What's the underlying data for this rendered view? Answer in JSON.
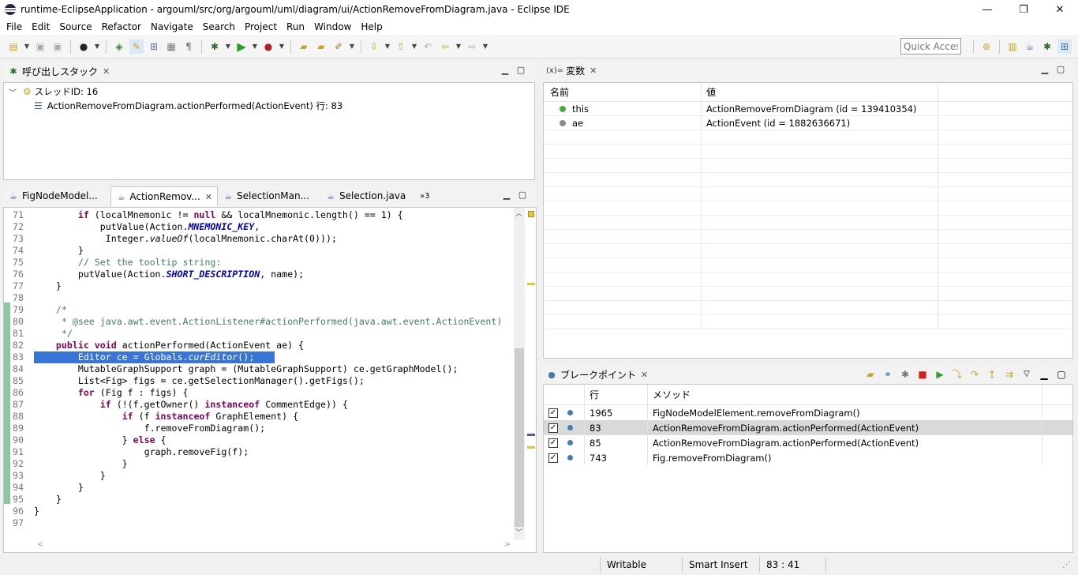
{
  "window": {
    "title": "runtime-EclipseApplication - argouml/src/org/argouml/uml/diagram/ui/ActionRemoveFromDiagram.java - Eclipse IDE",
    "minimize": "—",
    "maximize": "❐",
    "close": "✕"
  },
  "menu": [
    "File",
    "Edit",
    "Source",
    "Refactor",
    "Navigate",
    "Search",
    "Project",
    "Run",
    "Window",
    "Help"
  ],
  "toolbar": {
    "quick_access": "Quick Access"
  },
  "callstack": {
    "tab_label": "呼び出しスタック",
    "thread_label": "スレッドID: 16",
    "frame_label": "ActionRemoveFromDiagram.actionPerformed(ActionEvent) 行: 83"
  },
  "editor": {
    "tabs": [
      "FigNodeModel...",
      "ActionRemov...",
      "SelectionMan...",
      "Selection.java"
    ],
    "overflow": "»3",
    "lines": [
      {
        "n": "71",
        "code": "        if (localMnemonic != null && localMnemonic.length() == 1) {"
      },
      {
        "n": "72",
        "code": "            putValue(Action.MNEMONIC_KEY,"
      },
      {
        "n": "73",
        "code": "             Integer.valueOf(localMnemonic.charAt(0)));"
      },
      {
        "n": "74",
        "code": "        }"
      },
      {
        "n": "75",
        "code": "        // Set the tooltip string:"
      },
      {
        "n": "76",
        "code": "        putValue(Action.SHORT_DESCRIPTION, name);"
      },
      {
        "n": "77",
        "code": "    }"
      },
      {
        "n": "78",
        "code": ""
      },
      {
        "n": "79",
        "code": "    /*"
      },
      {
        "n": "80",
        "code": "     * @see java.awt.event.ActionListener#actionPerformed(java.awt.event.ActionEvent)"
      },
      {
        "n": "81",
        "code": "     */"
      },
      {
        "n": "82",
        "code": "    public void actionPerformed(ActionEvent ae) {"
      },
      {
        "n": "83",
        "code": "        Editor ce = Globals.curEditor();"
      },
      {
        "n": "84",
        "code": "        MutableGraphSupport graph = (MutableGraphSupport) ce.getGraphModel();"
      },
      {
        "n": "85",
        "code": "        List<Fig> figs = ce.getSelectionManager().getFigs();"
      },
      {
        "n": "86",
        "code": "        for (Fig f : figs) {"
      },
      {
        "n": "87",
        "code": "            if (!(f.getOwner() instanceof CommentEdge)) {"
      },
      {
        "n": "88",
        "code": "                if (f instanceof GraphElement) {"
      },
      {
        "n": "89",
        "code": "                    f.removeFromDiagram();"
      },
      {
        "n": "90",
        "code": "                } else {"
      },
      {
        "n": "91",
        "code": "                    graph.removeFig(f);"
      },
      {
        "n": "92",
        "code": "                }"
      },
      {
        "n": "93",
        "code": "            }"
      },
      {
        "n": "94",
        "code": "        }"
      },
      {
        "n": "95",
        "code": "    }"
      },
      {
        "n": "96",
        "code": "}"
      },
      {
        "n": "97",
        "code": ""
      }
    ]
  },
  "variables": {
    "tab_label": "変数",
    "tab_prefix": "(x)=",
    "col_name": "名前",
    "col_value": "値",
    "rows": [
      {
        "name": "this",
        "value": "ActionRemoveFromDiagram  (id = 139410354)",
        "color": "#49a942"
      },
      {
        "name": "ae",
        "value": "ActionEvent  (id = 1882636671)",
        "color": "#8a8a8a"
      }
    ]
  },
  "breakpoints": {
    "tab_label": "ブレークポイント",
    "col_line": "行",
    "col_method": "メソッド",
    "rows": [
      {
        "line": "1965",
        "method": "FigNodeModelElement.removeFromDiagram()"
      },
      {
        "line": "83",
        "method": "ActionRemoveFromDiagram.actionPerformed(ActionEvent)"
      },
      {
        "line": "85",
        "method": "ActionRemoveFromDiagram.actionPerformed(ActionEvent)"
      },
      {
        "line": "743",
        "method": "Fig.removeFromDiagram()"
      }
    ]
  },
  "status": {
    "writable": "Writable",
    "insert_mode": "Smart Insert",
    "position": "83 : 41"
  }
}
